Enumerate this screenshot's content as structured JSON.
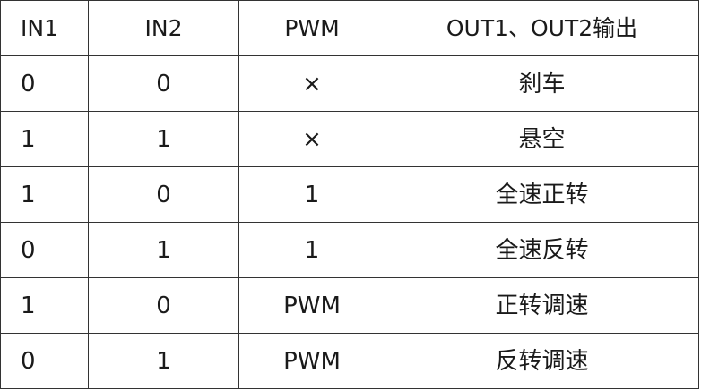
{
  "table": {
    "headers": [
      "IN1",
      "IN2",
      "PWM",
      "OUT1、OUT2输出"
    ],
    "rows": [
      [
        "0",
        "0",
        "×",
        "刹车"
      ],
      [
        "1",
        "1",
        "×",
        "悬空"
      ],
      [
        "1",
        "0",
        "1",
        "全速正转"
      ],
      [
        "0",
        "1",
        "1",
        "全速反转"
      ],
      [
        "1",
        "0",
        "PWM",
        "正转调速"
      ],
      [
        "0",
        "1",
        "PWM",
        "反转调速"
      ]
    ]
  }
}
